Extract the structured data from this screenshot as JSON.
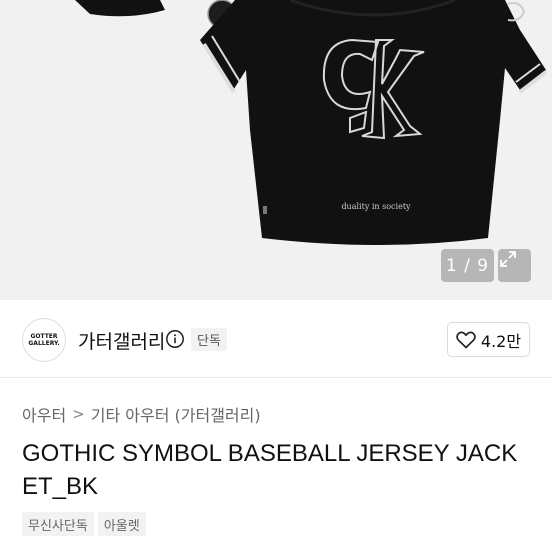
{
  "gallery": {
    "counter": "1 / 9",
    "jersey_print_text": "duality in society"
  },
  "brand": {
    "logo_line1": "GOTTER",
    "logo_line2": "GALLERY.",
    "name": "가터갤러리",
    "badge": "단독"
  },
  "like": {
    "count": "4.2만"
  },
  "breadcrumb": {
    "items": [
      "아우터",
      "기타 아우터 (가터갤러리)"
    ],
    "separator": ">"
  },
  "product": {
    "title": "GOTHIC SYMBOL BASEBALL JERSEY JACKET_BK"
  },
  "tags": [
    "무신사단독",
    "아울렛"
  ],
  "icons": {
    "info": "info-circle-icon",
    "heart": "heart-icon",
    "expand": "expand-arrows-icon"
  },
  "colors": {
    "hero_bg": "#f1f1f1",
    "jersey": "#111111",
    "tag_bg": "#f2f2f2"
  }
}
